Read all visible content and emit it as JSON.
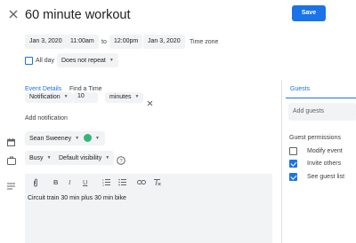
{
  "header": {
    "title": "60 minute workout",
    "save_label": "Save"
  },
  "datetime": {
    "start_date": "Jan 3, 2020",
    "start_time": "11:00am",
    "to_label": "to",
    "end_time": "12:00pm",
    "end_date": "Jan 3, 2020",
    "timezone_label": "Time zone",
    "all_day_label": "All day",
    "all_day_checked": false,
    "repeat_value": "Does not repeat"
  },
  "tabs": {
    "event_details": "Event Details",
    "find_time": "Find a Time",
    "guests": "Guests"
  },
  "notification": {
    "type": "Notification",
    "amount": "10",
    "unit": "minutes",
    "add_label": "Add notification"
  },
  "calendar": {
    "owner": "Sean Sweeney",
    "color": "#33b679"
  },
  "availability": {
    "busy": "Busy",
    "visibility": "Default visibility"
  },
  "description": {
    "text": "Circuit train 30 min plus 30 min bike"
  },
  "guests": {
    "add_placeholder": "Add guests",
    "permissions_label": "Guest permissions",
    "permissions": [
      {
        "label": "Modify event",
        "checked": false
      },
      {
        "label": "Invite others",
        "checked": true
      },
      {
        "label": "See guest list",
        "checked": true
      }
    ]
  },
  "colors": {
    "accent": "#1a73e8",
    "chip_bg": "#f1f3f4"
  }
}
